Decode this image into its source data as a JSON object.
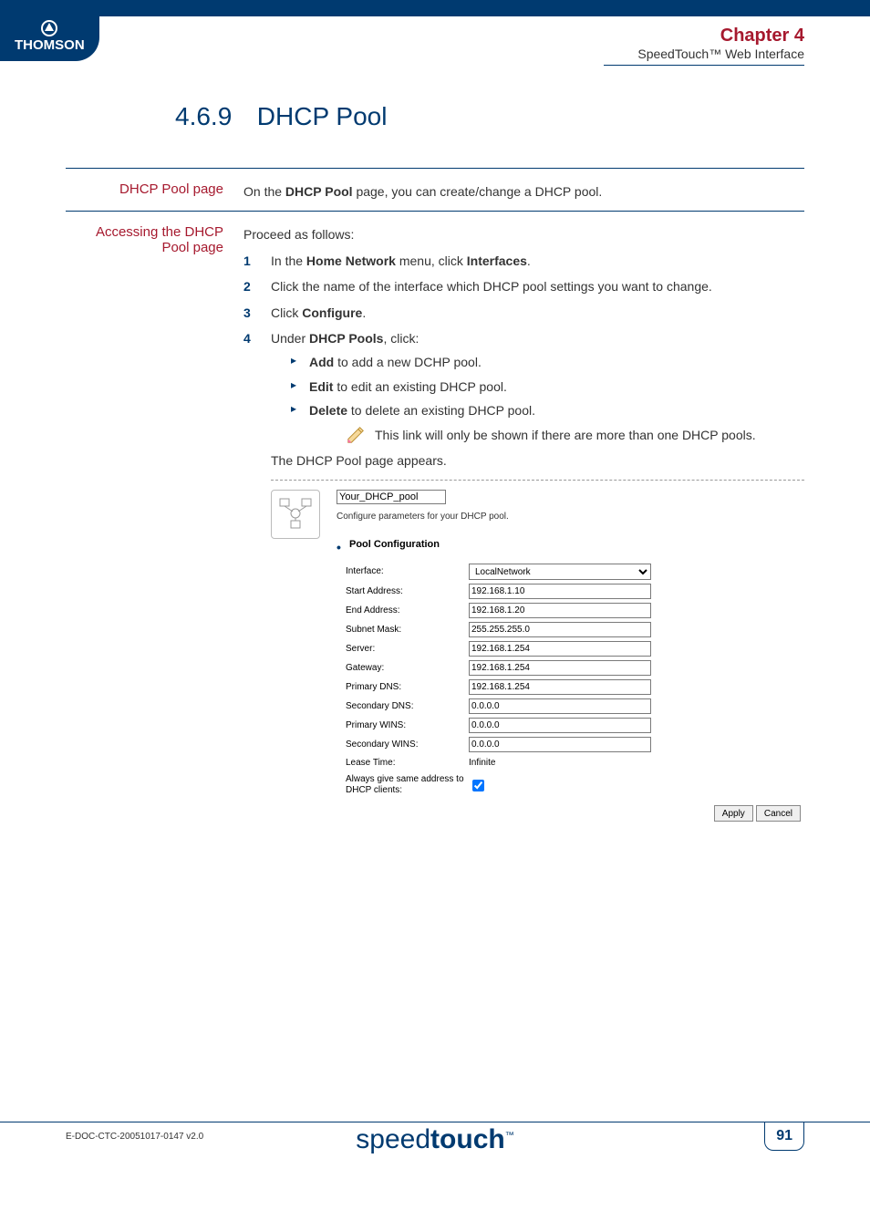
{
  "header": {
    "logo_text": "THOMSON",
    "chapter_label": "Chapter 4",
    "chapter_subtitle": "SpeedTouch™ Web Interface"
  },
  "section": {
    "number": "4.6.9",
    "title": "DHCP Pool"
  },
  "block1": {
    "label": "DHCP Pool page",
    "text_before": "On the ",
    "text_bold": "DHCP Pool",
    "text_after": " page, you can create/change a DHCP pool."
  },
  "block2": {
    "label": "Accessing the DHCP Pool page",
    "intro": "Proceed as follows:",
    "step1_a": "In the ",
    "step1_b": "Home Network",
    "step1_c": " menu, click ",
    "step1_d": "Interfaces",
    "step1_e": ".",
    "step2": "Click the name of the interface which DHCP pool settings you want to change.",
    "step3_a": "Click ",
    "step3_b": "Configure",
    "step3_c": ".",
    "step4_a": "Under ",
    "step4_b": "DHCP Pools",
    "step4_c": ", click:",
    "sub1_b": "Add",
    "sub1_t": " to add a new DCHP pool.",
    "sub2_b": "Edit",
    "sub2_t": " to edit an existing DHCP pool.",
    "sub3_b": "Delete",
    "sub3_t": " to delete an existing DHCP pool.",
    "note": "This link will only be shown if there are more than one DHCP pools.",
    "outro": "The DHCP Pool page appears."
  },
  "panel": {
    "name_value": "Your_DHCP_pool",
    "description": "Configure parameters for your DHCP pool.",
    "heading": "Pool Configuration",
    "rows": {
      "interface": {
        "label": "Interface:",
        "value": "LocalNetwork"
      },
      "start": {
        "label": "Start Address:",
        "value": "192.168.1.10"
      },
      "end": {
        "label": "End Address:",
        "value": "192.168.1.20"
      },
      "subnet": {
        "label": "Subnet Mask:",
        "value": "255.255.255.0"
      },
      "server": {
        "label": "Server:",
        "value": "192.168.1.254"
      },
      "gateway": {
        "label": "Gateway:",
        "value": "192.168.1.254"
      },
      "pdns": {
        "label": "Primary DNS:",
        "value": "192.168.1.254"
      },
      "sdns": {
        "label": "Secondary DNS:",
        "value": "0.0.0.0"
      },
      "pwins": {
        "label": "Primary WINS:",
        "value": "0.0.0.0"
      },
      "swins": {
        "label": "Secondary WINS:",
        "value": "0.0.0.0"
      },
      "lease": {
        "label": "Lease Time:",
        "value": "Infinite"
      },
      "always": {
        "label": "Always give same address to DHCP clients:"
      }
    },
    "apply": "Apply",
    "cancel": "Cancel"
  },
  "footer": {
    "docid": "E-DOC-CTC-20051017-0147 v2.0",
    "brand_light": "speed",
    "brand_bold": "touch",
    "brand_tm": "™",
    "page": "91"
  }
}
